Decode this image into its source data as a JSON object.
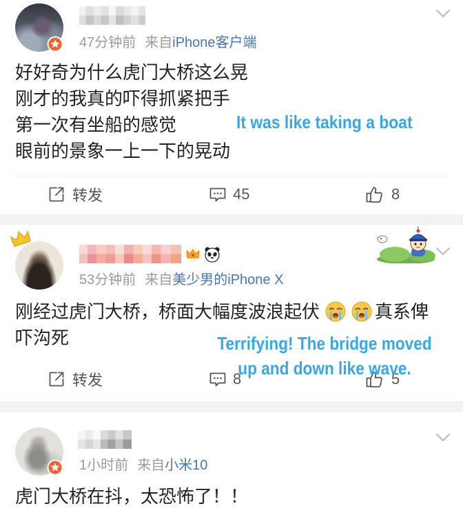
{
  "colors": {
    "text": "#222222",
    "meta": "#9b9b9b",
    "link": "#4575bb",
    "action": "#555555",
    "caption": "#35a8ec",
    "separator": "#f2f2f2",
    "badge": "#f2622c"
  },
  "icons": {
    "more": "chevron-down-icon",
    "repost": "share-icon",
    "comment": "comment-icon",
    "like": "thumbs-up-icon",
    "avatar_badge": "verified-badge-icon",
    "emoji": "loudly-crying-emoji-icon"
  },
  "posts": [
    {
      "time": "47分钟前",
      "source_prefix": "来自",
      "source": "iPhone客户端",
      "body_lines": [
        "好好奇为什么虎门大桥这么晃",
        "刚才的我真的吓得抓紧把手",
        "第一次有坐船的感觉",
        "眼前的景象一上一下的晃动"
      ],
      "caption_lines": [
        "It was like taking a boat"
      ],
      "actions": {
        "repost": "转发",
        "comments": "45",
        "likes": "8"
      }
    },
    {
      "time": "53分钟前",
      "source_prefix": "来自",
      "source": "美少男的iPhone X",
      "name_badges": [
        "crown-badge-icon",
        "panda-icon"
      ],
      "avatar_decoration": "crown-decoration-icon",
      "sticker": "cartoon-character-sticker",
      "body": {
        "line1_text": "刚经过虎门大桥，桥面大幅度波浪起伏",
        "line1_emojis": [
          "loudly-crying-emoji-icon",
          "loudly-crying-emoji-icon"
        ],
        "line1_tail": "真系俾",
        "line2": "吓沟死"
      },
      "caption_lines": [
        "Terrifying! The bridge moved",
        "up and down like wave."
      ],
      "actions": {
        "repost": "转发",
        "comments": "8",
        "likes": "5"
      }
    },
    {
      "time": "1小时前",
      "source_prefix": "来自",
      "source": "小米10",
      "body_lines": [
        "虎门大桥在抖，太恐怖了！！"
      ]
    }
  ]
}
